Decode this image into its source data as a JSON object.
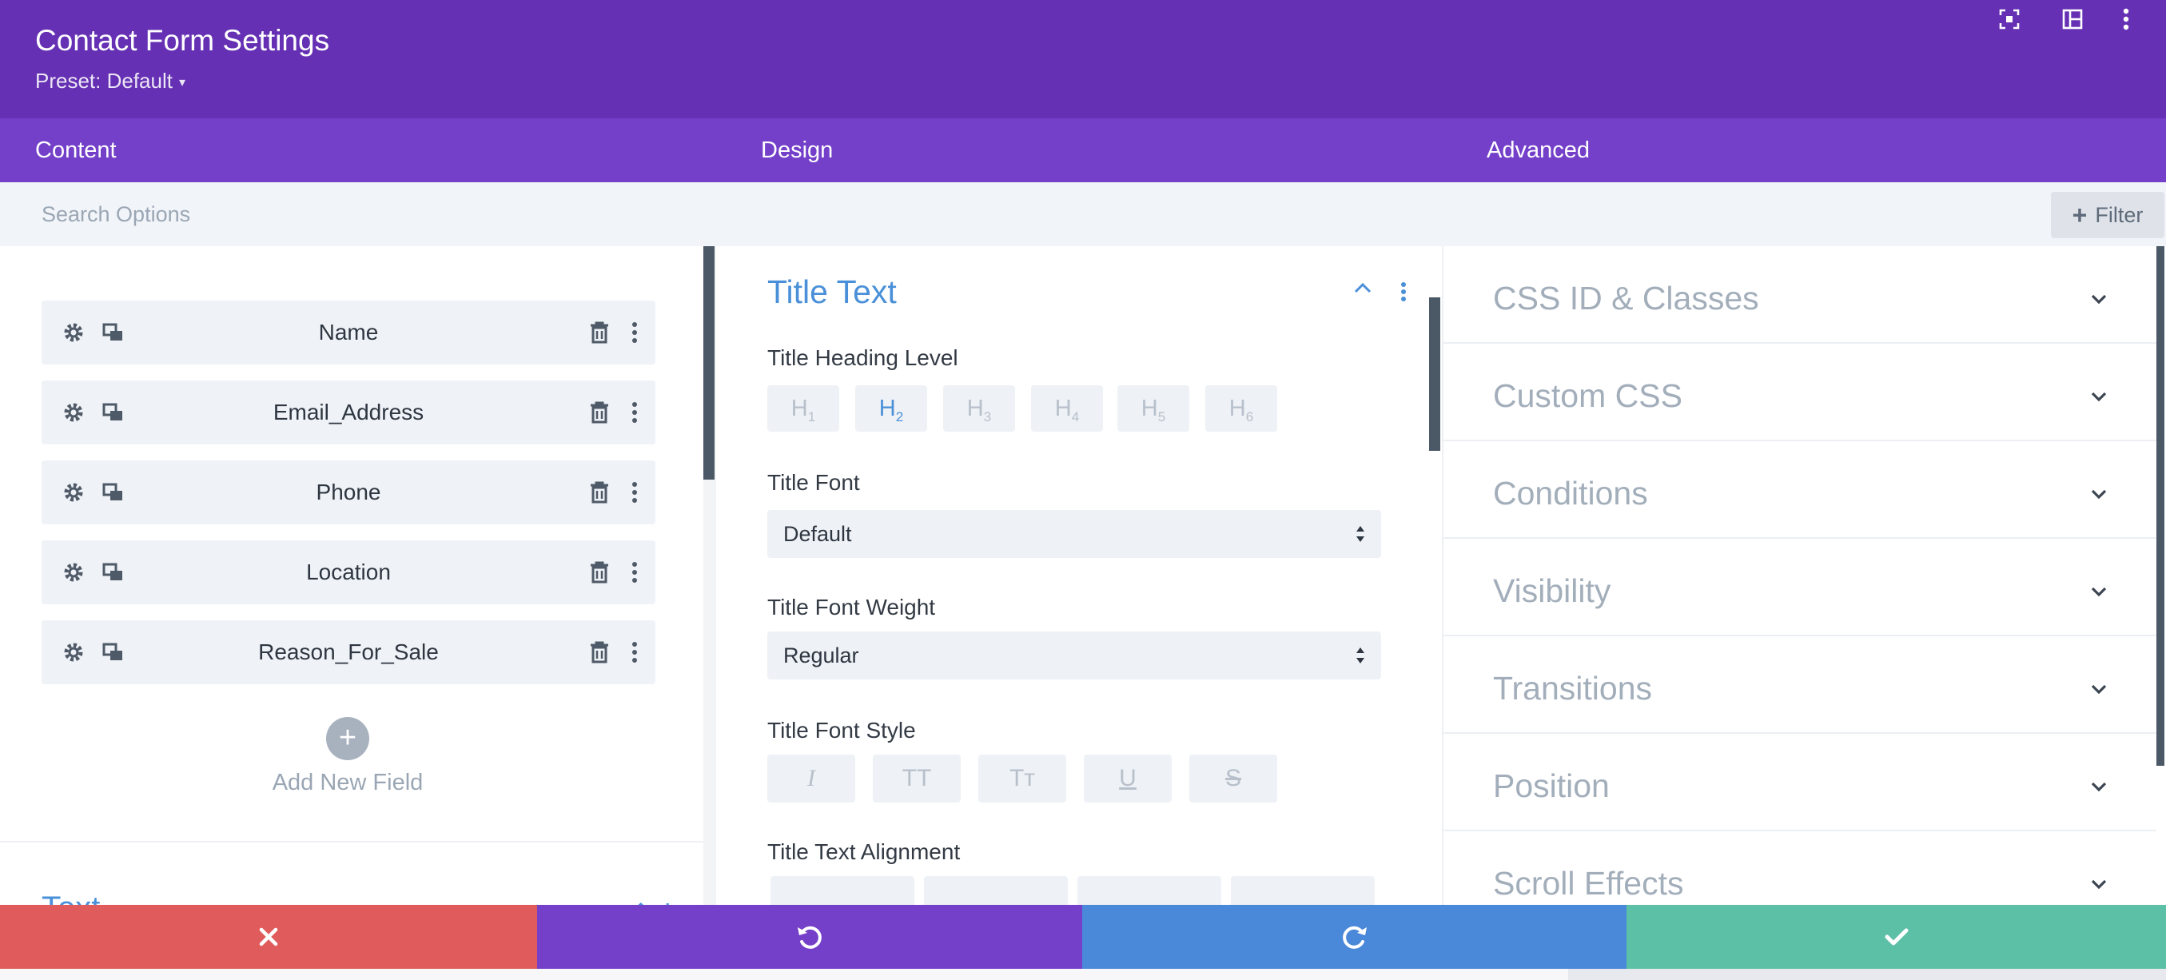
{
  "header": {
    "title": "Contact Form Settings",
    "preset": "Preset: Default",
    "icons": [
      "focus-icon",
      "split-view-icon",
      "more-vertical-icon"
    ]
  },
  "tabs": [
    {
      "label": "Content"
    },
    {
      "label": "Design"
    },
    {
      "label": "Advanced"
    }
  ],
  "search": {
    "placeholder": "Search Options",
    "filter_label": "Filter"
  },
  "content": {
    "fields": [
      {
        "label": "Name"
      },
      {
        "label": "Email_Address"
      },
      {
        "label": "Phone"
      },
      {
        "label": "Location"
      },
      {
        "label": "Reason_For_Sale"
      }
    ],
    "add_field_label": "Add New Field",
    "next_section": "Text"
  },
  "design": {
    "section_title": "Title Text",
    "heading_level_label": "Title Heading Level",
    "heading_levels": [
      "H1",
      "H2",
      "H3",
      "H4",
      "H5",
      "H6"
    ],
    "active_heading": "H2",
    "font_label": "Title Font",
    "font_value": "Default",
    "weight_label": "Title Font Weight",
    "weight_value": "Regular",
    "style_label": "Title Font Style",
    "style_buttons": [
      "I",
      "TT",
      "Tт",
      "U",
      "S"
    ],
    "alignment_label": "Title Text Alignment"
  },
  "advanced": {
    "items": [
      {
        "label": "CSS ID & Classes"
      },
      {
        "label": "Custom CSS"
      },
      {
        "label": "Conditions"
      },
      {
        "label": "Visibility"
      },
      {
        "label": "Transitions"
      },
      {
        "label": "Position"
      },
      {
        "label": "Scroll Effects"
      }
    ]
  },
  "colors": {
    "header": "#6530b3",
    "tabs": "#7440c9",
    "accent_blue": "#4a90d9",
    "cancel": "#e05c5c",
    "undo": "#7440c9",
    "redo": "#4a88d9",
    "save": "#5cc0a6"
  }
}
